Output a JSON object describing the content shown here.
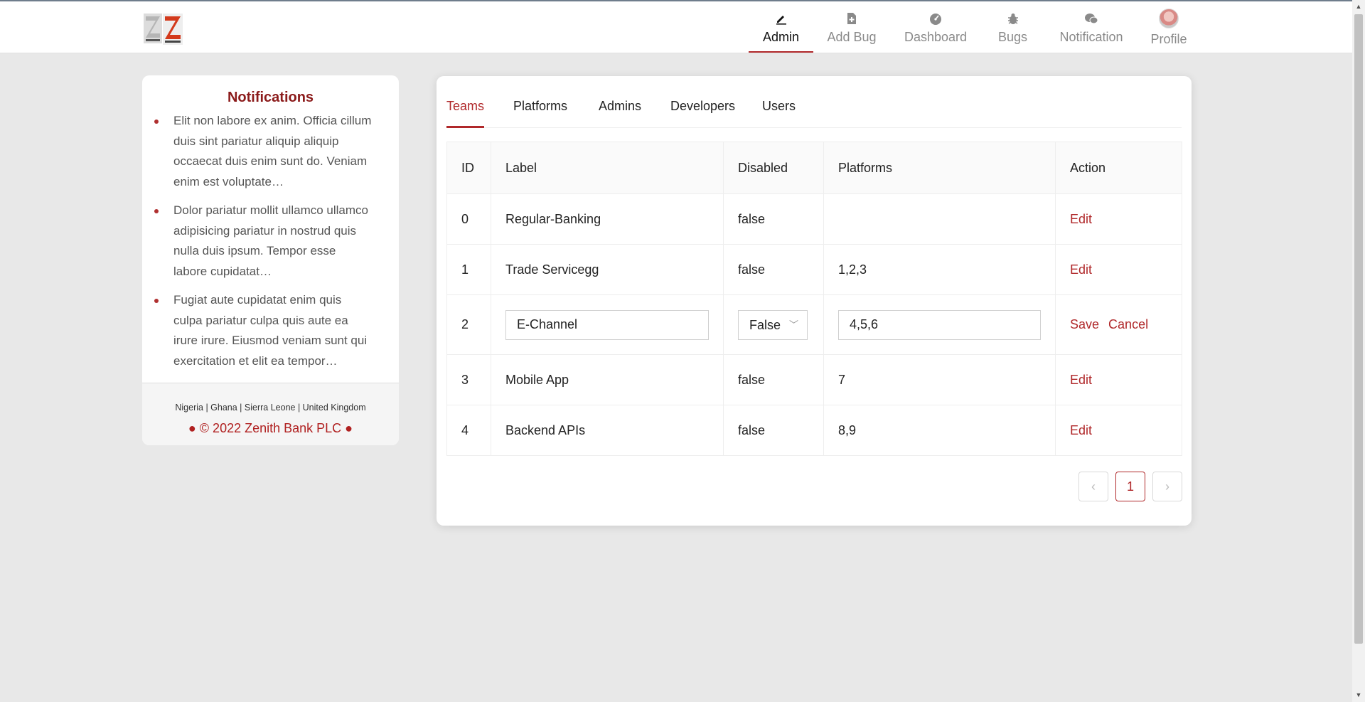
{
  "nav": {
    "admin": "Admin",
    "add_bug": "Add Bug",
    "dashboard": "Dashboard",
    "bugs": "Bugs",
    "notification": "Notification",
    "profile": "Profile"
  },
  "notifications": {
    "title": "Notifications",
    "items": [
      "Elit non labore ex anim. Officia cillum duis sint pariatur aliquip aliquip occaecat duis enim sunt do. Veniam enim est voluptate…",
      "Dolor pariatur mollit ullamco ullamco adipisicing pariatur in nostrud quis nulla duis ipsum. Tempor esse labore cupidatat…",
      "Fugiat aute cupidatat enim quis culpa pariatur culpa quis aute ea irure irure. Eiusmod veniam sunt qui exercitation et elit ea tempor…"
    ],
    "countries": "Nigeria | Ghana | Sierra Leone | United Kingdom",
    "copyright": "● © 2022 Zenith Bank PLC ●"
  },
  "tabs": [
    "Teams",
    "Platforms",
    "Admins",
    "Developers",
    "Users"
  ],
  "table": {
    "headers": [
      "ID",
      "Label",
      "Disabled",
      "Platforms",
      "Action"
    ],
    "rows": [
      {
        "id": "0",
        "label": "Regular-Banking",
        "disabled": "false",
        "platforms": "",
        "action": "Edit"
      },
      {
        "id": "1",
        "label": "Trade Servicegg",
        "disabled": "false",
        "platforms": "1,2,3",
        "action": "Edit"
      },
      {
        "id": "2",
        "label": "E-Channel",
        "disabled": "False",
        "platforms": "4,5,6",
        "save": "Save",
        "cancel": "Cancel"
      },
      {
        "id": "3",
        "label": "Mobile App",
        "disabled": "false",
        "platforms": "7",
        "action": "Edit"
      },
      {
        "id": "4",
        "label": "Backend APIs",
        "disabled": "false",
        "platforms": "8,9",
        "action": "Edit"
      }
    ]
  },
  "pagination": {
    "current": "1",
    "prev_icon": "chevron-left-icon",
    "next_icon": "chevron-right-icon"
  },
  "colors": {
    "accent": "#b0282a",
    "background": "#e8e8e8"
  }
}
